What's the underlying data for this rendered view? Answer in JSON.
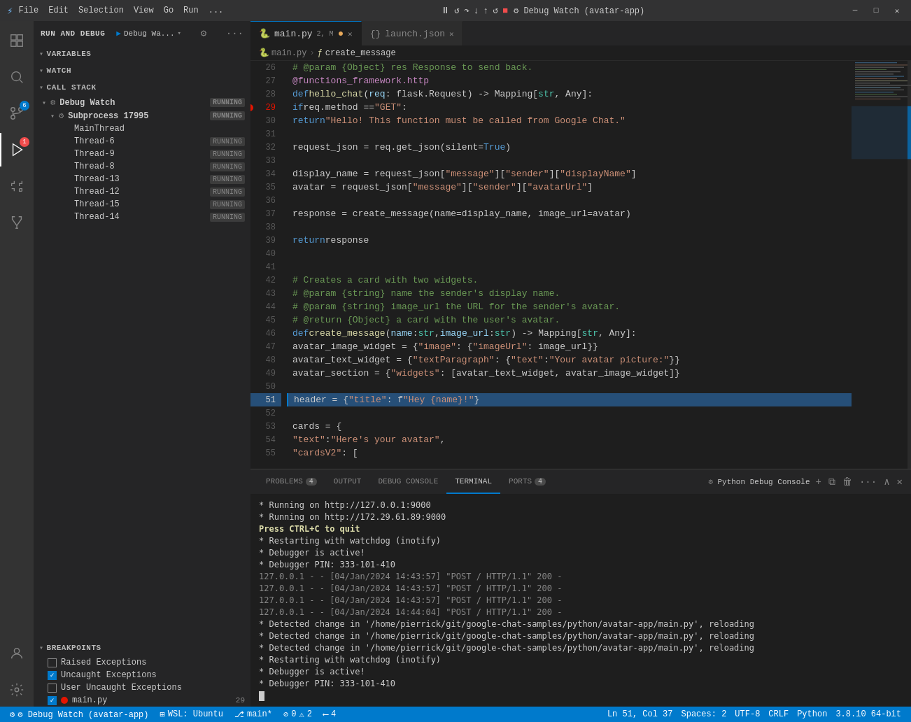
{
  "titlebar": {
    "icon": "⚡",
    "menu": [
      "File",
      "Edit",
      "Selection",
      "View",
      "Go",
      "Run",
      "..."
    ],
    "window_title": "main.py - Debug Watch (avatar-app)",
    "controls": [
      "─",
      "□",
      "✕"
    ]
  },
  "debug_panel": {
    "title": "RUN AND DEBUG",
    "config": "Debug Wa...",
    "variables_label": "VARIABLES",
    "watch_label": "WATCH",
    "callstack_label": "CALL STACK",
    "breakpoints_label": "BREAKPOINTS"
  },
  "callstack": {
    "items": [
      {
        "level": 0,
        "icon": "⚙",
        "name": "Debug Watch",
        "status": "RUNNING",
        "expand": true
      },
      {
        "level": 1,
        "icon": "⚙",
        "name": "Subprocess 17995",
        "status": "RUNNING",
        "expand": true
      },
      {
        "level": 2,
        "icon": "",
        "name": "MainThread",
        "status": ""
      },
      {
        "level": 2,
        "icon": "",
        "name": "Thread-6",
        "status": "RUNNING"
      },
      {
        "level": 2,
        "icon": "",
        "name": "Thread-9",
        "status": "RUNNING"
      },
      {
        "level": 2,
        "icon": "",
        "name": "Thread-8",
        "status": "RUNNING"
      },
      {
        "level": 2,
        "icon": "",
        "name": "Thread-13",
        "status": "RUNNING"
      },
      {
        "level": 2,
        "icon": "",
        "name": "Thread-12",
        "status": "RUNNING"
      },
      {
        "level": 2,
        "icon": "",
        "name": "Thread-15",
        "status": "RUNNING"
      },
      {
        "level": 2,
        "icon": "",
        "name": "Thread-14",
        "status": "RUNNING"
      }
    ]
  },
  "breakpoints": {
    "items": [
      {
        "type": "checkbox",
        "checked": false,
        "label": "Raised Exceptions"
      },
      {
        "type": "checkbox",
        "checked": true,
        "label": "Uncaught Exceptions"
      },
      {
        "type": "checkbox",
        "checked": false,
        "label": "User Uncaught Exceptions"
      },
      {
        "type": "file",
        "checked": true,
        "label": "main.py",
        "line": "29"
      }
    ]
  },
  "tabs": [
    {
      "label": "main.py",
      "modified": true,
      "badge": "2, M",
      "icon": "🐍",
      "active": true,
      "close": true
    },
    {
      "label": "launch.json",
      "icon": "⚙",
      "active": false,
      "close": true
    }
  ],
  "breadcrumb": {
    "file": "main.py",
    "symbol": "create_message"
  },
  "code": {
    "lines": [
      {
        "num": 26,
        "content": "    <cm># @param {Object} res Response to send back.</cm>"
      },
      {
        "num": 27,
        "content": "    <dec>@functions_framework.http</dec>"
      },
      {
        "num": 28,
        "content": "    <kw>def</kw> <fn>hello_chat</fn>(<param>req</param>: flask.Request) -> Mapping[<cls>str</cls>, Any]:"
      },
      {
        "num": 29,
        "content": "        <kw>if</kw> req.method == <str>\"GET\"</str>:",
        "breakpoint": true
      },
      {
        "num": 30,
        "content": "            <kw>return</kw> <str>\"Hello! This function must be called from Google Chat.\"</str>"
      },
      {
        "num": 31,
        "content": ""
      },
      {
        "num": 32,
        "content": "        request_json = req.get_json(silent=<kw>True</kw>)"
      },
      {
        "num": 33,
        "content": ""
      },
      {
        "num": 34,
        "content": "        display_name = request_json[<str>\"message\"</str>][<str>\"sender\"</str>][<str>\"displayName\"</str>]"
      },
      {
        "num": 35,
        "content": "        avatar = request_json[<str>\"message\"</str>][<str>\"sender\"</str>][<str>\"avatarUrl\"</str>]"
      },
      {
        "num": 36,
        "content": ""
      },
      {
        "num": 37,
        "content": "        response = create_message(name=display_name, image_url=avatar)"
      },
      {
        "num": 38,
        "content": ""
      },
      {
        "num": 39,
        "content": "        <kw>return</kw> response"
      },
      {
        "num": 40,
        "content": ""
      },
      {
        "num": 41,
        "content": ""
      },
      {
        "num": 42,
        "content": "    <cm># Creates a card with two widgets.</cm>"
      },
      {
        "num": 43,
        "content": "    <cm># @param {string} name the sender's display name.</cm>"
      },
      {
        "num": 44,
        "content": "    <cm># @param {string} image_url the URL for the sender's avatar.</cm>"
      },
      {
        "num": 45,
        "content": "    <cm># @return {Object} a card with the user's avatar.</cm>"
      },
      {
        "num": 46,
        "content": "    <kw>def</kw> <fn>create_message</fn>(<param>name</param>: <cls>str</cls>, <param>image_url</param>: <cls>str</cls>) -> Mapping[<cls>str</cls>, Any]:"
      },
      {
        "num": 47,
        "content": "        avatar_image_widget = {<str>\"image\"</str>: {<str>\"imageUrl\"</str>: image_url}}"
      },
      {
        "num": 48,
        "content": "        avatar_text_widget = {<str>\"textParagraph\"</str>: {<str>\"text\"</str>: <str>\"Your avatar picture:\"</str>}}"
      },
      {
        "num": 49,
        "content": "        avatar_section = {<str>\"widgets\"</str>: [avatar_text_widget, avatar_image_widget]}"
      },
      {
        "num": 50,
        "content": ""
      },
      {
        "num": 51,
        "content": "        header = {<str>\"title\"</str>: f<str>\"Hey {name}!\"</str>}",
        "current": true
      },
      {
        "num": 52,
        "content": ""
      },
      {
        "num": 53,
        "content": "        cards = {"
      },
      {
        "num": 54,
        "content": "            <str>\"text\"</str>: <str>\"Here's your avatar\"</str>,"
      },
      {
        "num": 55,
        "content": "            <str>\"cardsV2\"</str>: ["
      }
    ]
  },
  "panel_tabs": [
    {
      "label": "PROBLEMS",
      "badge": "4",
      "active": false
    },
    {
      "label": "OUTPUT",
      "badge": "",
      "active": false
    },
    {
      "label": "DEBUG CONSOLE",
      "badge": "",
      "active": false
    },
    {
      "label": "TERMINAL",
      "badge": "",
      "active": true
    },
    {
      "label": "PORTS",
      "badge": "4",
      "active": false
    }
  ],
  "terminal": {
    "python_debug_console": "Python Debug Console",
    "lines": [
      {
        "type": "plain",
        "text": " * Running on http://127.0.0.1:9000"
      },
      {
        "type": "plain",
        "text": " * Running on http://172.29.61.89:9000"
      },
      {
        "type": "ctrl",
        "text": "Press CTRL+C to quit"
      },
      {
        "type": "plain",
        "text": " * Restarting with watchdog (inotify)"
      },
      {
        "type": "plain",
        "text": " * Debugger is active!"
      },
      {
        "type": "plain",
        "text": " * Debugger PIN: 333-101-410"
      },
      {
        "type": "dim",
        "text": "127.0.0.1 - - [04/Jan/2024 14:43:57] \"POST / HTTP/1.1\" 200 -"
      },
      {
        "type": "dim",
        "text": "127.0.0.1 - - [04/Jan/2024 14:43:57] \"POST / HTTP/1.1\" 200 -"
      },
      {
        "type": "dim",
        "text": "127.0.0.1 - - [04/Jan/2024 14:43:57] \"POST / HTTP/1.1\" 200 -"
      },
      {
        "type": "dim",
        "text": "127.0.0.1 - - [04/Jan/2024 14:44:04] \"POST / HTTP/1.1\" 200 -"
      },
      {
        "type": "plain",
        "text": " * Detected change in '/home/pierrick/git/google-chat-samples/python/avatar-app/main.py', reloading"
      },
      {
        "type": "plain",
        "text": " * Detected change in '/home/pierrick/git/google-chat-samples/python/avatar-app/main.py', reloading"
      },
      {
        "type": "plain",
        "text": " * Detected change in '/home/pierrick/git/google-chat-samples/python/avatar-app/main.py', reloading"
      },
      {
        "type": "plain",
        "text": " * Restarting with watchdog (inotify)"
      },
      {
        "type": "plain",
        "text": " * Debugger is active!"
      },
      {
        "type": "plain",
        "text": " * Debugger PIN: 333-101-410"
      }
    ]
  },
  "status_bar": {
    "debug_indicator": "⚙ Debug Watch (avatar-app)",
    "wsl": "⊞ WSL: Ubuntu",
    "git_branch": "main*",
    "errors": "⊘ 0",
    "warnings": "⚠ 2",
    "ssh": "⟵ 4",
    "debug_watch": "⚙ Debug Watch (avatar-app)",
    "cursor_pos": "Ln 51, Col 37",
    "spaces": "Spaces: 2",
    "encoding": "UTF-8",
    "line_ending": "CRLF",
    "language": "Python",
    "version": "3.8.10 64-bit"
  }
}
